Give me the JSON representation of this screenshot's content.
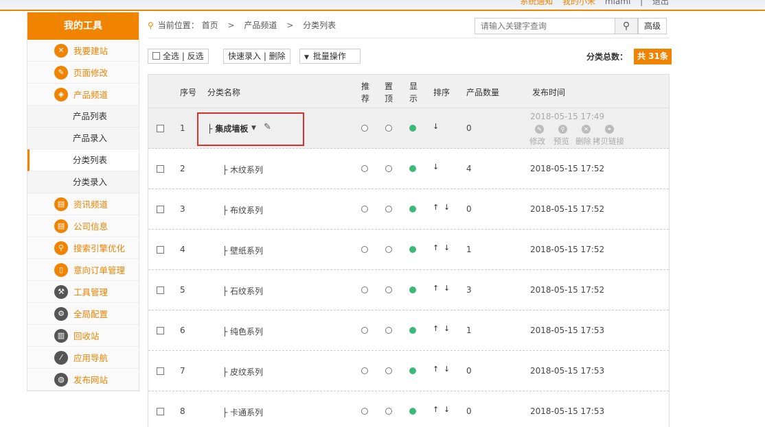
{
  "topbar": {
    "link1": "系统通知",
    "link2": "我的小米",
    "user": "miami",
    "logout": "退出"
  },
  "sidebar": {
    "title": "我的工具",
    "items": [
      {
        "label": "我要建站",
        "icon": "tools-icon",
        "glyph": "✕"
      },
      {
        "label": "页面修改",
        "icon": "pencil-icon",
        "glyph": "✎"
      },
      {
        "label": "产品频道",
        "icon": "product-icon",
        "glyph": "◈"
      }
    ],
    "subitems": [
      {
        "label": "产品列表"
      },
      {
        "label": "产品录入"
      },
      {
        "label": "分类列表"
      },
      {
        "label": "分类录入"
      }
    ],
    "items2": [
      {
        "label": "资讯频道",
        "icon": "news-icon",
        "glyph": "▤",
        "dark": false
      },
      {
        "label": "公司信息",
        "icon": "company-icon",
        "glyph": "▤",
        "dark": false
      },
      {
        "label": "搜索引擎优化",
        "icon": "search-seo-icon",
        "glyph": "⚲",
        "dark": false
      },
      {
        "label": "意向订单管理",
        "icon": "order-icon",
        "glyph": "▯",
        "dark": false
      },
      {
        "label": "工具管理",
        "icon": "wrench-icon",
        "glyph": "⚒",
        "dark": true
      },
      {
        "label": "全局配置",
        "icon": "gear-icon",
        "glyph": "⚙",
        "dark": true
      },
      {
        "label": "回收站",
        "icon": "trash-icon",
        "glyph": "▥",
        "dark": true
      },
      {
        "label": "应用导航",
        "icon": "brush-icon",
        "glyph": "⁄",
        "dark": true
      },
      {
        "label": "发布网站",
        "icon": "globe-icon",
        "glyph": "◍",
        "dark": true
      }
    ]
  },
  "breadcrumb": {
    "prefix": "当前位置：",
    "home": "首页",
    "sep": ">",
    "level1": "产品频道",
    "level2": "分类列表"
  },
  "search": {
    "placeholder": "请输入关键字查询",
    "advanced": "高级"
  },
  "toolbar": {
    "select_all": "全选 | 反选",
    "quick_entry": "快速录入 | 删除",
    "batch": "批量操作",
    "total_label": "分类总数：",
    "total_value": "共 31条"
  },
  "table": {
    "headers": {
      "num": "序号",
      "name": "分类名称",
      "recommend_1": "推",
      "recommend_2": "荐",
      "top_1": "置",
      "top_2": "顶",
      "show_1": "显",
      "show_2": "示",
      "sort": "排序",
      "count": "产品数量",
      "time": "发布时间"
    },
    "ops": {
      "edit": "修改",
      "preview": "预览",
      "delete": "删除",
      "copy": "拷贝链接"
    },
    "rows": [
      {
        "num": "1",
        "name": "├ 集成墙板",
        "up": false,
        "down": true,
        "count": "0",
        "time": "2018-05-15 17:49"
      },
      {
        "num": "2",
        "name": "├ 木纹系列",
        "up": false,
        "down": true,
        "count": "4",
        "time": "2018-05-15 17:52"
      },
      {
        "num": "3",
        "name": "├ 布纹系列",
        "up": true,
        "down": true,
        "count": "0",
        "time": "2018-05-15 17:52"
      },
      {
        "num": "4",
        "name": "├ 壁纸系列",
        "up": true,
        "down": true,
        "count": "1",
        "time": "2018-05-15 17:52"
      },
      {
        "num": "5",
        "name": "├ 石纹系列",
        "up": true,
        "down": true,
        "count": "3",
        "time": "2018-05-15 17:52"
      },
      {
        "num": "6",
        "name": "├ 纯色系列",
        "up": true,
        "down": true,
        "count": "1",
        "time": "2018-05-15 17:53"
      },
      {
        "num": "7",
        "name": "├ 皮纹系列",
        "up": true,
        "down": true,
        "count": "0",
        "time": "2018-05-15 17:53"
      },
      {
        "num": "8",
        "name": "├ 卡通系列",
        "up": true,
        "down": true,
        "count": "0",
        "time": "2018-05-15 17:53"
      }
    ]
  }
}
